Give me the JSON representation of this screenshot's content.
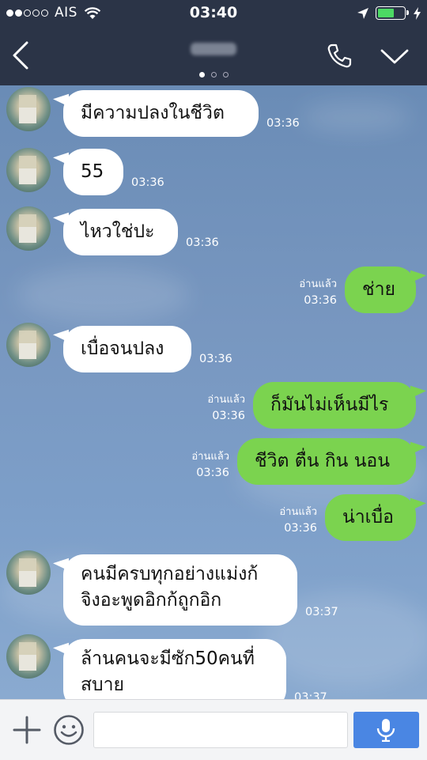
{
  "status_bar": {
    "carrier": "AIS",
    "time": "03:40",
    "signal_dots": [
      true,
      true,
      false,
      false,
      false
    ],
    "battery_level": 0.55,
    "icons": [
      "signal-dots-icon",
      "wifi-icon",
      "location-arrow-icon",
      "battery-icon",
      "charging-bolt-icon"
    ]
  },
  "header": {
    "back_icon": "back-chevron-icon",
    "call_icon": "phone-icon",
    "menu_icon": "chevron-down-icon",
    "page_dots": [
      true,
      false,
      false
    ]
  },
  "messages": [
    {
      "side": "in",
      "text": "มีความปลงในชีวิต",
      "time": "03:36"
    },
    {
      "side": "in",
      "text": "55",
      "time": "03:36"
    },
    {
      "side": "in",
      "text": "ไหวใช่ปะ",
      "time": "03:36"
    },
    {
      "side": "out",
      "text": "ช่าย",
      "time": "03:36",
      "read": "อ่านแล้ว"
    },
    {
      "side": "in",
      "text": "เบื่อจนปลง",
      "time": "03:36"
    },
    {
      "side": "out",
      "text": "ก็มันไม่เห็นมีไร",
      "time": "03:36",
      "read": "อ่านแล้ว"
    },
    {
      "side": "out",
      "text": "ชีวิต ตื่น กิน นอน",
      "time": "03:36",
      "read": "อ่านแล้ว"
    },
    {
      "side": "out",
      "text": "น่าเบื่อ",
      "time": "03:36",
      "read": "อ่านแล้ว"
    },
    {
      "side": "in",
      "lines": [
        "คนมีครบทุกอย่างแม่งก้",
        "จิงอะพูดอิกก้ถูกอิก"
      ],
      "time": "03:37"
    },
    {
      "side": "in",
      "lines": [
        "ล้านคนจะมีซัก50คนที่",
        "สบาย"
      ],
      "time": "03:37"
    }
  ],
  "input_bar": {
    "placeholder": "",
    "value": "",
    "icons": [
      "plus-icon",
      "emoji-icon",
      "microphone-icon"
    ]
  },
  "colors": {
    "header_bg": "#2b3447",
    "chat_bg": "#6f8fb5",
    "incoming_bubble": "#ffffff",
    "outgoing_bubble": "#7bd34f",
    "send_button": "#4a86e3"
  }
}
